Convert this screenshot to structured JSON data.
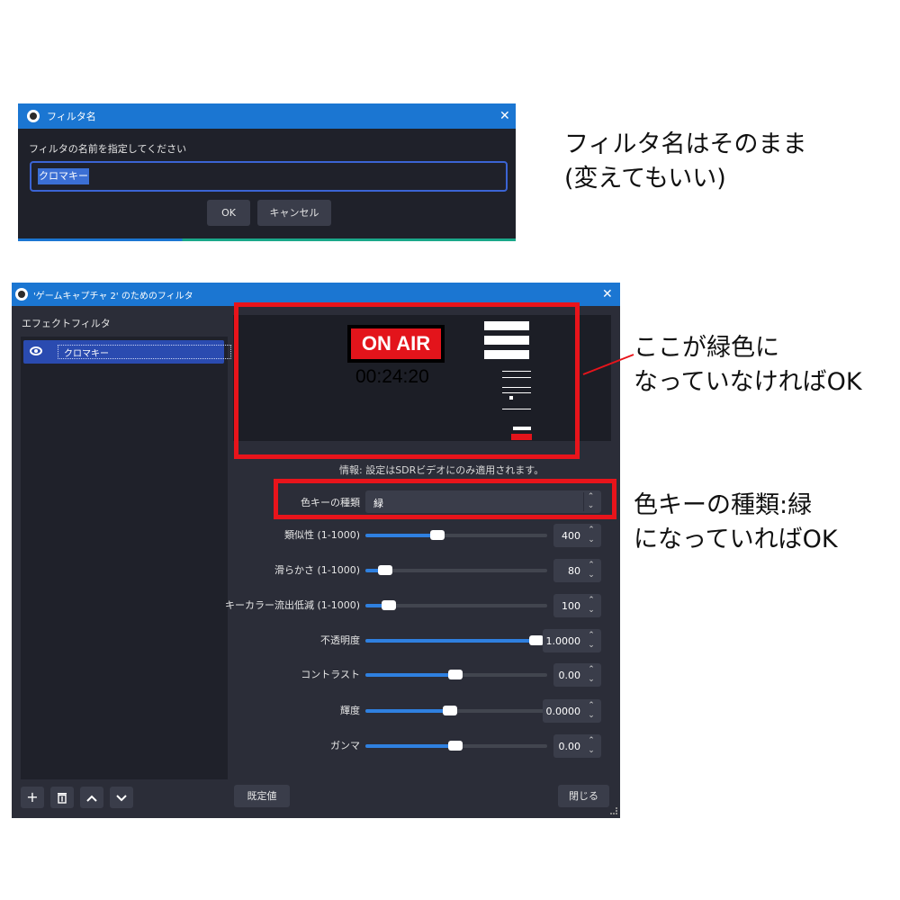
{
  "rename_dialog": {
    "title": "フィルタ名",
    "prompt": "フィルタの名前を指定してください",
    "input_value": "クロマキー",
    "ok_label": "OK",
    "cancel_label": "キャンセル"
  },
  "annotations": {
    "rename_note_line1": "フィルタ名はそのまま",
    "rename_note_line2": "(変えてもいい)",
    "preview_note_line1": "ここが緑色に",
    "preview_note_line2": "なっていなければOK",
    "keytype_note_line1": "色キーの種類:緑",
    "keytype_note_line2": "になっていればOK"
  },
  "filters_dialog": {
    "title": "'ゲームキャプチャ 2' のためのフィルタ",
    "effect_filters_label": "エフェクトフィルタ",
    "filter_items": [
      {
        "label": "クロマキー",
        "visible": true
      }
    ],
    "preview": {
      "on_air_text": "ON AIR",
      "timer_text": "00:24:20"
    },
    "info_text": "情報: 設定はSDRビデオにのみ適用されます。",
    "key_type": {
      "label": "色キーの種類",
      "value": "緑"
    },
    "sliders": [
      {
        "label": "類似性 (1-1000)",
        "value_text": "400",
        "fraction": 0.4
      },
      {
        "label": "滑らかさ (1-1000)",
        "value_text": "80",
        "fraction": 0.11
      },
      {
        "label": "キーカラー流出低減 (1-1000)",
        "value_text": "100",
        "fraction": 0.13
      },
      {
        "label": "不透明度",
        "value_text": "1.0000",
        "fraction": 1.0
      },
      {
        "label": "コントラスト",
        "value_text": "0.00",
        "fraction": 0.5
      },
      {
        "label": "輝度",
        "value_text": "0.0000",
        "fraction": 0.47
      },
      {
        "label": "ガンマ",
        "value_text": "0.00",
        "fraction": 0.5
      }
    ],
    "reset_label": "既定値",
    "close_label": "閉じる"
  },
  "icons": {
    "app": "obs-logo-icon",
    "close": "close-icon",
    "visibility": "eye-icon",
    "add": "plus-icon",
    "remove": "trash-icon",
    "move_up": "chevron-up-icon",
    "move_down": "chevron-down-icon"
  },
  "colors": {
    "titlebar": "#1b76d2",
    "highlight": "#e8141b",
    "slider_fill": "#2f80e0",
    "dialog_bg": "#2b2d38"
  }
}
